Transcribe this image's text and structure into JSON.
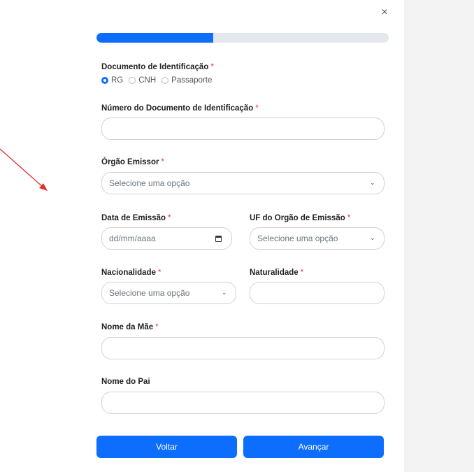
{
  "dialog": {
    "close_glyph": "×",
    "progress_fraction": 0.4
  },
  "form": {
    "document_type": {
      "label": "Documento de Identificação",
      "required": "*",
      "options": [
        "RG",
        "CNH",
        "Passaporte"
      ],
      "selected": "RG"
    },
    "document_number": {
      "label": "Número do Documento de Identificação",
      "required": "*",
      "value": ""
    },
    "issuer": {
      "label": "Órgão Emissor",
      "required": "*",
      "value": "Selecione uma opção"
    },
    "issue_date": {
      "label": "Data de Emissão",
      "required": "*",
      "placeholder": "dd/mm/aaaa"
    },
    "issuer_state": {
      "label": "UF do Orgão de Emissão",
      "required": "*",
      "value": "Selecione uma opção"
    },
    "nationality": {
      "label": "Nacionalidade",
      "required": "*",
      "value": "Selecione uma opção"
    },
    "birthplace": {
      "label": "Naturalidade",
      "required": "*",
      "value": ""
    },
    "mother_name": {
      "label": "Nome da Mãe",
      "required": "*",
      "value": ""
    },
    "father_name": {
      "label": "Nome do Pai",
      "value": ""
    }
  },
  "buttons": {
    "back": "Voltar",
    "next": "Avançar"
  },
  "colors": {
    "primary": "#0d6efd",
    "required": "#dc3545",
    "annotation_arrow": "#e0302a"
  }
}
